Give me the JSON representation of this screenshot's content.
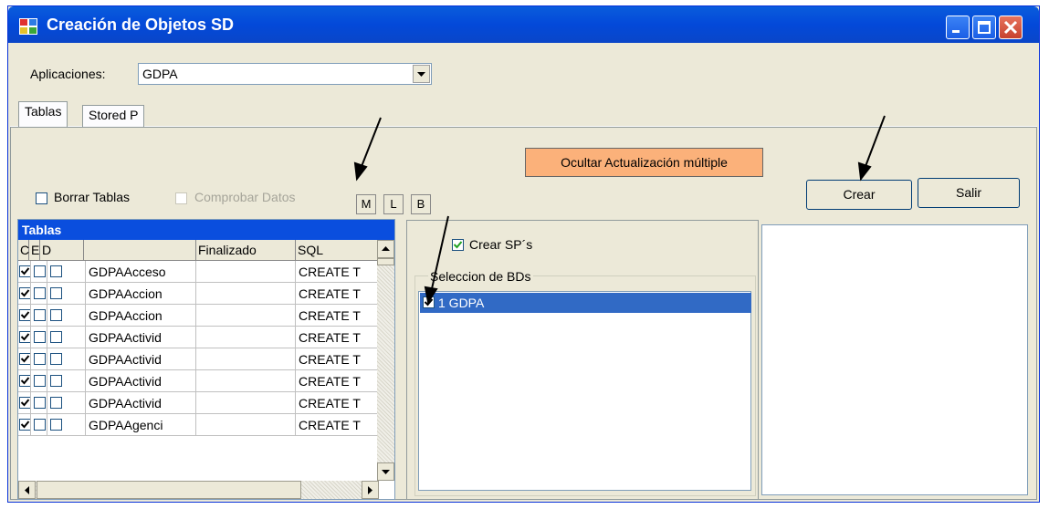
{
  "window": {
    "title": "Creación de Objetos SD"
  },
  "header": {
    "aplicaciones_label": "Aplicaciones:",
    "aplicaciones_value": "GDPA"
  },
  "tabs": [
    {
      "label": "Tablas"
    },
    {
      "label": "Stored P"
    }
  ],
  "toolbar": {
    "ocultar_label": "Ocultar Actualización múltiple",
    "crear_label": "Crear",
    "salir_label": "Salir",
    "m_label": "M",
    "l_label": "L",
    "b_label": "B",
    "borrar_tablas_label": "Borrar Tablas",
    "comprobar_datos_label": "Comprobar Datos"
  },
  "grid": {
    "caption": "Tablas",
    "columns": [
      "C",
      "E",
      "D",
      "",
      "Finalizado",
      "SQL"
    ],
    "rows": [
      {
        "c": true,
        "e": false,
        "d": false,
        "name": "GDPAAcceso",
        "finalizado": "",
        "sql": "CREATE T"
      },
      {
        "c": true,
        "e": false,
        "d": false,
        "name": "GDPAAccion",
        "finalizado": "",
        "sql": "CREATE T"
      },
      {
        "c": true,
        "e": false,
        "d": false,
        "name": "GDPAAccion",
        "finalizado": "",
        "sql": "CREATE T"
      },
      {
        "c": true,
        "e": false,
        "d": false,
        "name": "GDPAActivid",
        "finalizado": "",
        "sql": "CREATE T"
      },
      {
        "c": true,
        "e": false,
        "d": false,
        "name": "GDPAActivid",
        "finalizado": "",
        "sql": "CREATE T"
      },
      {
        "c": true,
        "e": false,
        "d": false,
        "name": "GDPAActivid",
        "finalizado": "",
        "sql": "CREATE T"
      },
      {
        "c": true,
        "e": false,
        "d": false,
        "name": "GDPAActivid",
        "finalizado": "",
        "sql": "CREATE T"
      },
      {
        "c": true,
        "e": false,
        "d": false,
        "name": "GDPAAgenci",
        "finalizado": "",
        "sql": "CREATE T"
      }
    ]
  },
  "sp_panel": {
    "crear_sps_label": "Crear SP´s",
    "crear_sps_checked": true,
    "seleccion_label": "Seleccion de BDs",
    "bds": [
      {
        "label": "1 GDPA",
        "checked": true
      }
    ]
  },
  "colors": {
    "title_bar": "#0a5ddc",
    "orange_button": "#fbb17a",
    "selection": "#316ac5",
    "grid_caption": "#0a4ede"
  }
}
